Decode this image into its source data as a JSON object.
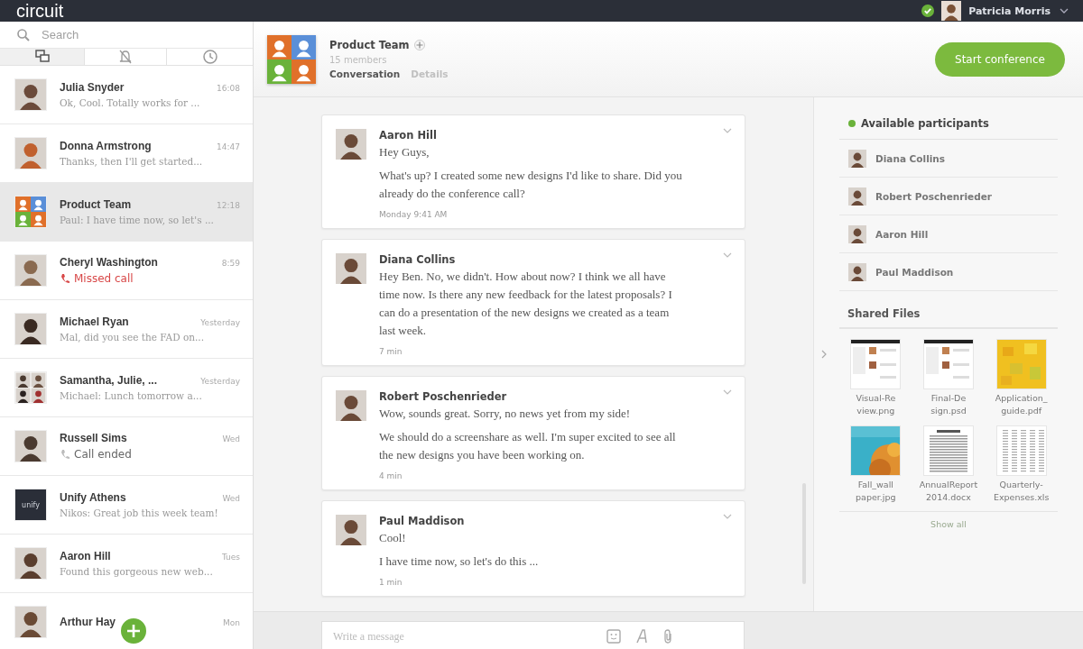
{
  "header": {
    "logo": "circuit",
    "user": {
      "name": "Patricia Morris",
      "online": true
    }
  },
  "sidebar": {
    "search": {
      "placeholder": "Search"
    },
    "tabs": [
      {
        "kind": "chat",
        "selected": true
      },
      {
        "kind": "bell",
        "selected": false
      },
      {
        "kind": "clock",
        "selected": false
      }
    ],
    "conversations": [
      {
        "name": "Julia Snyder",
        "time": "16:08",
        "preview": "Ok, Cool. Totally works for ...",
        "kind": "message",
        "avatar": {
          "kind": "person",
          "color": "#6b4a3a"
        },
        "selected": false
      },
      {
        "name": "Donna Armstrong",
        "time": "14:47",
        "preview": "Thanks, then I'll get started...",
        "kind": "message",
        "avatar": {
          "kind": "person",
          "color": "#c0602e"
        },
        "selected": false
      },
      {
        "name": "Product Team",
        "time": "12:18",
        "preview": "Paul: I have time now, so let's ...",
        "kind": "message",
        "avatar": {
          "kind": "team"
        },
        "selected": true
      },
      {
        "name": "Cheryl Washington",
        "time": "8:59",
        "preview": "Missed call",
        "kind": "missed_call",
        "avatar": {
          "kind": "person",
          "color": "#8a6a50"
        },
        "selected": false
      },
      {
        "name": "Michael Ryan",
        "time": "Yesterday",
        "preview": "Mal, did you see the FAD on...",
        "kind": "message",
        "avatar": {
          "kind": "person",
          "color": "#3a2a22"
        },
        "selected": false
      },
      {
        "name": "Samantha, Julie, ...",
        "time": "Yesterday",
        "preview": "Michael: Lunch tomorrow a...",
        "kind": "message",
        "avatar": {
          "kind": "group"
        },
        "selected": false
      },
      {
        "name": "Russell Sims",
        "time": "Wed",
        "preview": "Call ended",
        "kind": "call_ended",
        "avatar": {
          "kind": "person",
          "color": "#4a3a30"
        },
        "selected": false
      },
      {
        "name": "Unify Athens",
        "time": "Wed",
        "preview": "Nikos: Great job this week team!",
        "kind": "message",
        "avatar": {
          "kind": "logo",
          "text": "unify"
        },
        "selected": false
      },
      {
        "name": "Aaron Hill",
        "time": "Tues",
        "preview": "Found this gorgeous new web...",
        "kind": "message",
        "avatar": {
          "kind": "person",
          "color": "#5a3e2e"
        },
        "selected": false
      },
      {
        "name": "Arthur Hay",
        "time": "Mon",
        "avatar": {
          "kind": "person",
          "color": "#6a4a35"
        },
        "selected": false
      }
    ]
  },
  "conversation": {
    "title": "Product Team",
    "members": "15 members",
    "tabs": [
      {
        "label": "Conversation",
        "selected": true
      },
      {
        "label": "Details",
        "selected": false
      }
    ],
    "action": "Start conference",
    "messages": [
      {
        "author": "Aaron Hill",
        "paragraphs": [
          "Hey Guys,",
          "What's up? I created some new designs I'd like to share. Did you already do the conference call?"
        ],
        "time": "Monday 9:41 AM"
      },
      {
        "author": "Diana Collins",
        "paragraphs": [
          "Hey Ben. No, we didn't. How about now? I think we all have time now. Is there any new feedback for the latest proposals? I can do a presentation of the new designs we created as a team last week."
        ],
        "time": "7 min"
      },
      {
        "author": "Robert Poschenrieder",
        "paragraphs": [
          "Wow, sounds great. Sorry, no news yet from my side!",
          "We should do a screenshare as well. I'm super excited to see all the new designs you have been working on."
        ],
        "time": "4 min"
      },
      {
        "author": "Paul Maddison",
        "paragraphs": [
          "Cool!",
          "I have time now, so let's do this ..."
        ],
        "time": "1 min"
      }
    ],
    "composer": {
      "placeholder": "Write a message"
    }
  },
  "details": {
    "participants_title": "Available participants",
    "participants": [
      {
        "name": "Diana Collins"
      },
      {
        "name": "Robert Poschenrieder"
      },
      {
        "name": "Aaron Hill"
      },
      {
        "name": "Paul Maddison"
      }
    ],
    "files_title": "Shared Files",
    "files": [
      {
        "name": "Visual-Re\nview.png",
        "kind": "screen"
      },
      {
        "name": "Final-De\nsign.psd",
        "kind": "screen"
      },
      {
        "name": "Application_\nguide.pdf",
        "kind": "swatch"
      },
      {
        "name": "Fall_wall\npaper.jpg"
      },
      {
        "name": "AnnualReport\n2014.docx",
        "kind": "doc"
      },
      {
        "name": "Quarterly-\nExpenses.xls",
        "kind": "sheet"
      }
    ],
    "show_all": "Show all"
  }
}
